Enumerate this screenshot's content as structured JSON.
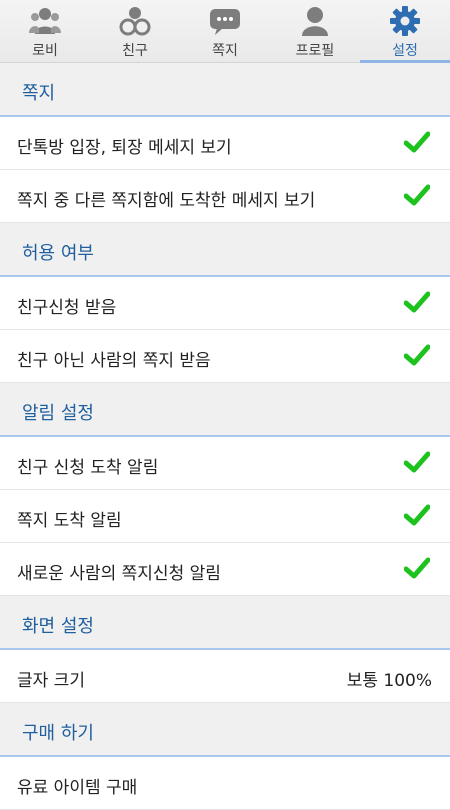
{
  "tabs": [
    {
      "label": "로비",
      "icon": "users-group-icon",
      "active": false
    },
    {
      "label": "친구",
      "icon": "friends-icon",
      "active": false
    },
    {
      "label": "쪽지",
      "icon": "chat-bubble-icon",
      "active": false
    },
    {
      "label": "프로필",
      "icon": "profile-icon",
      "active": false
    },
    {
      "label": "설정",
      "icon": "gear-icon",
      "active": true
    }
  ],
  "sections": [
    {
      "title": "쪽지",
      "items": [
        {
          "label": "단톡방 입장, 퇴장 메세지 보기",
          "checked": true
        },
        {
          "label": "쪽지 중 다른 쪽지함에 도착한 메세지 보기",
          "checked": true
        }
      ]
    },
    {
      "title": "허용 여부",
      "items": [
        {
          "label": "친구신청 받음",
          "checked": true
        },
        {
          "label": "친구 아닌 사람의 쪽지 받음",
          "checked": true
        }
      ]
    },
    {
      "title": "알림 설정",
      "items": [
        {
          "label": "친구 신청 도착 알림",
          "checked": true
        },
        {
          "label": "쪽지 도착 알림",
          "checked": true
        },
        {
          "label": "새로운 사람의 쪽지신청 알림",
          "checked": true
        }
      ]
    },
    {
      "title": "화면 설정",
      "items": [
        {
          "label": "글자 크기",
          "value": "보통 100%"
        }
      ]
    },
    {
      "title": "구매 하기",
      "items": [
        {
          "label": "유료 아이템 구매"
        }
      ]
    }
  ],
  "colors": {
    "accent": "#2f6db3",
    "check": "#1ec21e",
    "section_title": "#1f5f9e"
  }
}
